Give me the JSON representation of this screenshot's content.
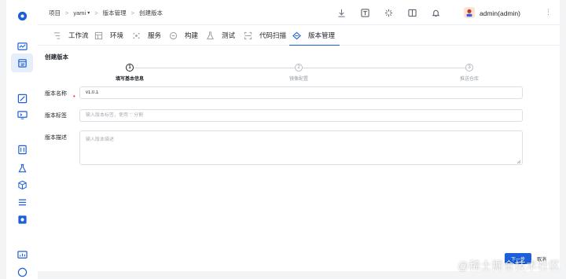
{
  "breadcrumb": {
    "root": "项目",
    "project": "yami",
    "section": "版本管理",
    "current": "创建版本",
    "separator": ">"
  },
  "header_icons": [
    "download-icon",
    "text-document-icon",
    "sparkle-icon",
    "book-icon",
    "bell-icon",
    "more-icon"
  ],
  "user": {
    "name": "admin(admin)"
  },
  "tabs": [
    {
      "label": "工作流",
      "icon": "workflow-icon",
      "active": false
    },
    {
      "label": "环境",
      "icon": "environment-icon",
      "active": false
    },
    {
      "label": "服务",
      "icon": "service-icon",
      "active": false
    },
    {
      "label": "构建",
      "icon": "build-icon",
      "active": false
    },
    {
      "label": "测试",
      "icon": "test-icon",
      "active": false
    },
    {
      "label": "代码扫描",
      "icon": "code-scan-icon",
      "active": false
    },
    {
      "label": "版本管理",
      "icon": "version-icon",
      "active": true
    }
  ],
  "page": {
    "title": "创建版本",
    "steps": [
      {
        "number": "1",
        "label": "填写基本信息",
        "active": true
      },
      {
        "number": "2",
        "label": "镜像配置",
        "active": false
      },
      {
        "number": "3",
        "label": "推送仓库",
        "active": false
      }
    ],
    "form": {
      "name_label": "版本名称",
      "name_value": "v1.0.1",
      "tags_label": "版本标签",
      "tags_placeholder": "输入版本标签，使用 ';' 分割",
      "desc_label": "版本描述",
      "desc_placeholder": "输入版本描述"
    },
    "buttons": {
      "next": "下一步",
      "cancel": "取消"
    }
  },
  "watermark": "@稀土掘金技术社区",
  "colors": {
    "primary": "#1d5fd6",
    "required": "#e23c3c",
    "background": "#f3f4f6"
  }
}
